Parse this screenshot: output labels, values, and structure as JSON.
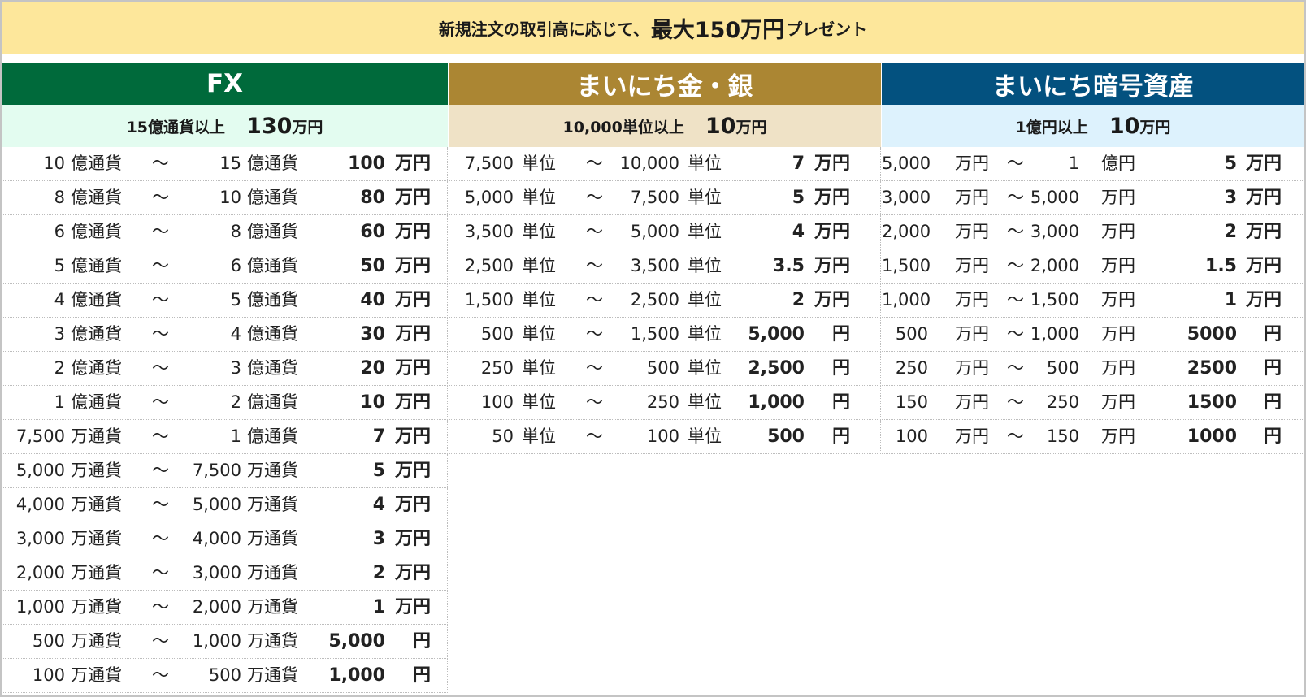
{
  "banner": {
    "text_before": "新規注文の取引高に応じて、",
    "highlight": "最大150万円",
    "text_after": "プレゼント"
  },
  "fx": {
    "title": "FX",
    "threshold": {
      "label": "15億通貨以上",
      "amount": "130",
      "unit": "万円"
    },
    "rows": [
      {
        "from_num": "10",
        "from_unit": "億通貨",
        "tilde": "～",
        "to_num": "15",
        "to_unit": "億通貨",
        "reward": "100",
        "reward_unit": "万円"
      },
      {
        "from_num": "8",
        "from_unit": "億通貨",
        "tilde": "～",
        "to_num": "10",
        "to_unit": "億通貨",
        "reward": "80",
        "reward_unit": "万円"
      },
      {
        "from_num": "6",
        "from_unit": "億通貨",
        "tilde": "～",
        "to_num": "8",
        "to_unit": "億通貨",
        "reward": "60",
        "reward_unit": "万円"
      },
      {
        "from_num": "5",
        "from_unit": "億通貨",
        "tilde": "～",
        "to_num": "6",
        "to_unit": "億通貨",
        "reward": "50",
        "reward_unit": "万円"
      },
      {
        "from_num": "4",
        "from_unit": "億通貨",
        "tilde": "～",
        "to_num": "5",
        "to_unit": "億通貨",
        "reward": "40",
        "reward_unit": "万円"
      },
      {
        "from_num": "3",
        "from_unit": "億通貨",
        "tilde": "～",
        "to_num": "4",
        "to_unit": "億通貨",
        "reward": "30",
        "reward_unit": "万円"
      },
      {
        "from_num": "2",
        "from_unit": "億通貨",
        "tilde": "～",
        "to_num": "3",
        "to_unit": "億通貨",
        "reward": "20",
        "reward_unit": "万円"
      },
      {
        "from_num": "1",
        "from_unit": "億通貨",
        "tilde": "～",
        "to_num": "2",
        "to_unit": "億通貨",
        "reward": "10",
        "reward_unit": "万円"
      },
      {
        "from_num": "7,500",
        "from_unit": "万通貨",
        "tilde": "～",
        "to_num": "1",
        "to_unit": "億通貨",
        "reward": "7",
        "reward_unit": "万円"
      },
      {
        "from_num": "5,000",
        "from_unit": "万通貨",
        "tilde": "～",
        "to_num": "7,500",
        "to_unit": "万通貨",
        "reward": "5",
        "reward_unit": "万円"
      },
      {
        "from_num": "4,000",
        "from_unit": "万通貨",
        "tilde": "～",
        "to_num": "5,000",
        "to_unit": "万通貨",
        "reward": "4",
        "reward_unit": "万円"
      },
      {
        "from_num": "3,000",
        "from_unit": "万通貨",
        "tilde": "～",
        "to_num": "4,000",
        "to_unit": "万通貨",
        "reward": "3",
        "reward_unit": "万円"
      },
      {
        "from_num": "2,000",
        "from_unit": "万通貨",
        "tilde": "～",
        "to_num": "3,000",
        "to_unit": "万通貨",
        "reward": "2",
        "reward_unit": "万円"
      },
      {
        "from_num": "1,000",
        "from_unit": "万通貨",
        "tilde": "～",
        "to_num": "2,000",
        "to_unit": "万通貨",
        "reward": "1",
        "reward_unit": "万円"
      },
      {
        "from_num": "500",
        "from_unit": "万通貨",
        "tilde": "～",
        "to_num": "1,000",
        "to_unit": "万通貨",
        "reward": "5,000",
        "reward_unit": "円"
      },
      {
        "from_num": "100",
        "from_unit": "万通貨",
        "tilde": "～",
        "to_num": "500",
        "to_unit": "万通貨",
        "reward": "1,000",
        "reward_unit": "円"
      }
    ]
  },
  "metal": {
    "title": "まいにち金・銀",
    "threshold": {
      "label": "10,000単位以上",
      "amount": "10",
      "unit": "万円"
    },
    "rows": [
      {
        "from_num": "7,500",
        "from_unit": "単位",
        "tilde": "～",
        "to_num": "10,000",
        "to_unit": "単位",
        "reward": "7",
        "reward_unit": "万円"
      },
      {
        "from_num": "5,000",
        "from_unit": "単位",
        "tilde": "～",
        "to_num": "7,500",
        "to_unit": "単位",
        "reward": "5",
        "reward_unit": "万円"
      },
      {
        "from_num": "3,500",
        "from_unit": "単位",
        "tilde": "～",
        "to_num": "5,000",
        "to_unit": "単位",
        "reward": "4",
        "reward_unit": "万円"
      },
      {
        "from_num": "2,500",
        "from_unit": "単位",
        "tilde": "～",
        "to_num": "3,500",
        "to_unit": "単位",
        "reward": "3.5",
        "reward_unit": "万円"
      },
      {
        "from_num": "1,500",
        "from_unit": "単位",
        "tilde": "～",
        "to_num": "2,500",
        "to_unit": "単位",
        "reward": "2",
        "reward_unit": "万円"
      },
      {
        "from_num": "500",
        "from_unit": "単位",
        "tilde": "～",
        "to_num": "1,500",
        "to_unit": "単位",
        "reward": "5,000",
        "reward_unit": "円"
      },
      {
        "from_num": "250",
        "from_unit": "単位",
        "tilde": "～",
        "to_num": "500",
        "to_unit": "単位",
        "reward": "2,500",
        "reward_unit": "円"
      },
      {
        "from_num": "100",
        "from_unit": "単位",
        "tilde": "～",
        "to_num": "250",
        "to_unit": "単位",
        "reward": "1,000",
        "reward_unit": "円"
      },
      {
        "from_num": "50",
        "from_unit": "単位",
        "tilde": "～",
        "to_num": "100",
        "to_unit": "単位",
        "reward": "500",
        "reward_unit": "円"
      }
    ]
  },
  "crypto": {
    "title": "まいにち暗号資産",
    "threshold": {
      "label": "1億円以上",
      "amount": "10",
      "unit": "万円"
    },
    "rows": [
      {
        "from_num": "5,000",
        "from_unit": "万円",
        "tilde": "～",
        "to_num": "1",
        "to_unit": "億円",
        "reward": "5",
        "reward_unit": "万円"
      },
      {
        "from_num": "3,000",
        "from_unit": "万円",
        "tilde": "～",
        "to_num": "5,000",
        "to_unit": "万円",
        "reward": "3",
        "reward_unit": "万円"
      },
      {
        "from_num": "2,000",
        "from_unit": "万円",
        "tilde": "～",
        "to_num": "3,000",
        "to_unit": "万円",
        "reward": "2",
        "reward_unit": "万円"
      },
      {
        "from_num": "1,500",
        "from_unit": "万円",
        "tilde": "～",
        "to_num": "2,000",
        "to_unit": "万円",
        "reward": "1.5",
        "reward_unit": "万円"
      },
      {
        "from_num": "1,000",
        "from_unit": "万円",
        "tilde": "～",
        "to_num": "1,500",
        "to_unit": "万円",
        "reward": "1",
        "reward_unit": "万円"
      },
      {
        "from_num": "500",
        "from_unit": "万円",
        "tilde": "～",
        "to_num": "1,000",
        "to_unit": "万円",
        "reward": "5000",
        "reward_unit": "円"
      },
      {
        "from_num": "250",
        "from_unit": "万円",
        "tilde": "～",
        "to_num": "500",
        "to_unit": "万円",
        "reward": "2500",
        "reward_unit": "円"
      },
      {
        "from_num": "150",
        "from_unit": "万円",
        "tilde": "～",
        "to_num": "250",
        "to_unit": "万円",
        "reward": "1500",
        "reward_unit": "円"
      },
      {
        "from_num": "100",
        "from_unit": "万円",
        "tilde": "～",
        "to_num": "150",
        "to_unit": "万円",
        "reward": "1000",
        "reward_unit": "円"
      }
    ]
  }
}
